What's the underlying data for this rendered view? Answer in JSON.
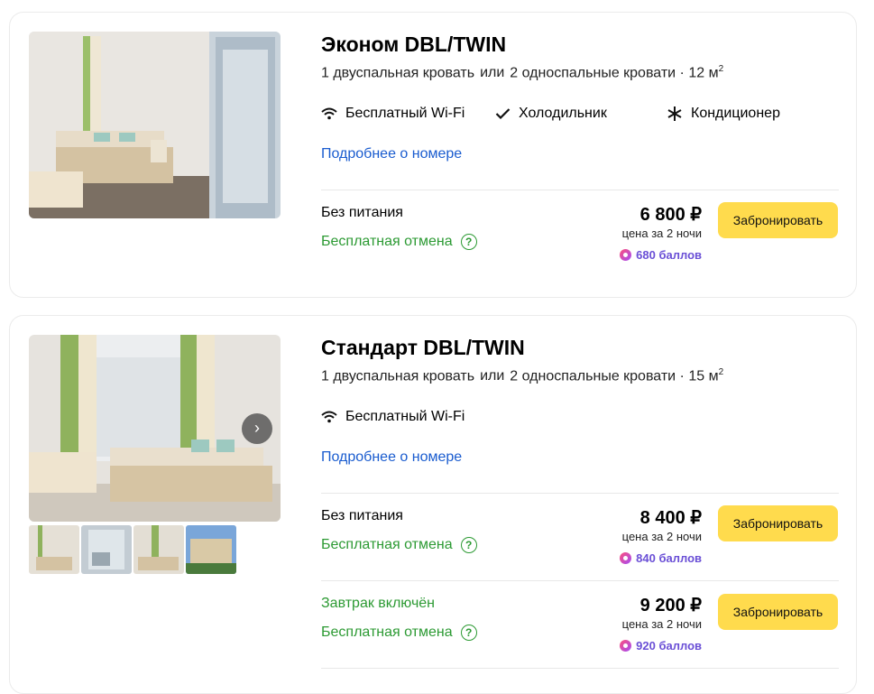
{
  "rooms": [
    {
      "name": "Эконом DBL/TWIN",
      "bed_double": "1 двуспальная кровать",
      "or": "или",
      "bed_twin": "2 односпальные кровати",
      "dot": "·",
      "area": "12 м",
      "area_sup": "2",
      "amenities": [
        {
          "icon": "wifi-icon",
          "label": "Бесплатный Wi-Fi"
        },
        {
          "icon": "checkmark-icon",
          "label": "Холодильник"
        },
        {
          "icon": "snowflake-icon",
          "label": "Кондиционер"
        }
      ],
      "details_link": "Подробнее о номере",
      "offers": [
        {
          "meal": "Без питания",
          "cancel": "Бесплатная отмена",
          "price": "6 800 ₽",
          "per": "цена за 2 ночи",
          "points": "680 баллов",
          "book": "Забронировать"
        }
      ]
    },
    {
      "name": "Стандарт DBL/TWIN",
      "bed_double": "1 двуспальная кровать",
      "or": "или",
      "bed_twin": "2 односпальные кровати",
      "dot": "·",
      "area": "15 м",
      "area_sup": "2",
      "amenities": [
        {
          "icon": "wifi-icon",
          "label": "Бесплатный Wi-Fi"
        }
      ],
      "details_link": "Подробнее о номере",
      "offers": [
        {
          "meal": "Без питания",
          "cancel": "Бесплатная отмена",
          "price": "8 400 ₽",
          "per": "цена за 2 ночи",
          "points": "840 баллов",
          "book": "Забронировать"
        },
        {
          "meal": "Завтрак включён",
          "cancel": "Бесплатная отмена",
          "price": "9 200 ₽",
          "per": "цена за 2 ночи",
          "points": "920 баллов",
          "book": "Забронировать"
        }
      ],
      "gallery_next": "›"
    }
  ],
  "colors": {
    "accent_yellow": "#ffdb4d",
    "link_blue": "#1a5ccf",
    "green": "#2c9a33",
    "points_purple": "#6a4fd6"
  }
}
